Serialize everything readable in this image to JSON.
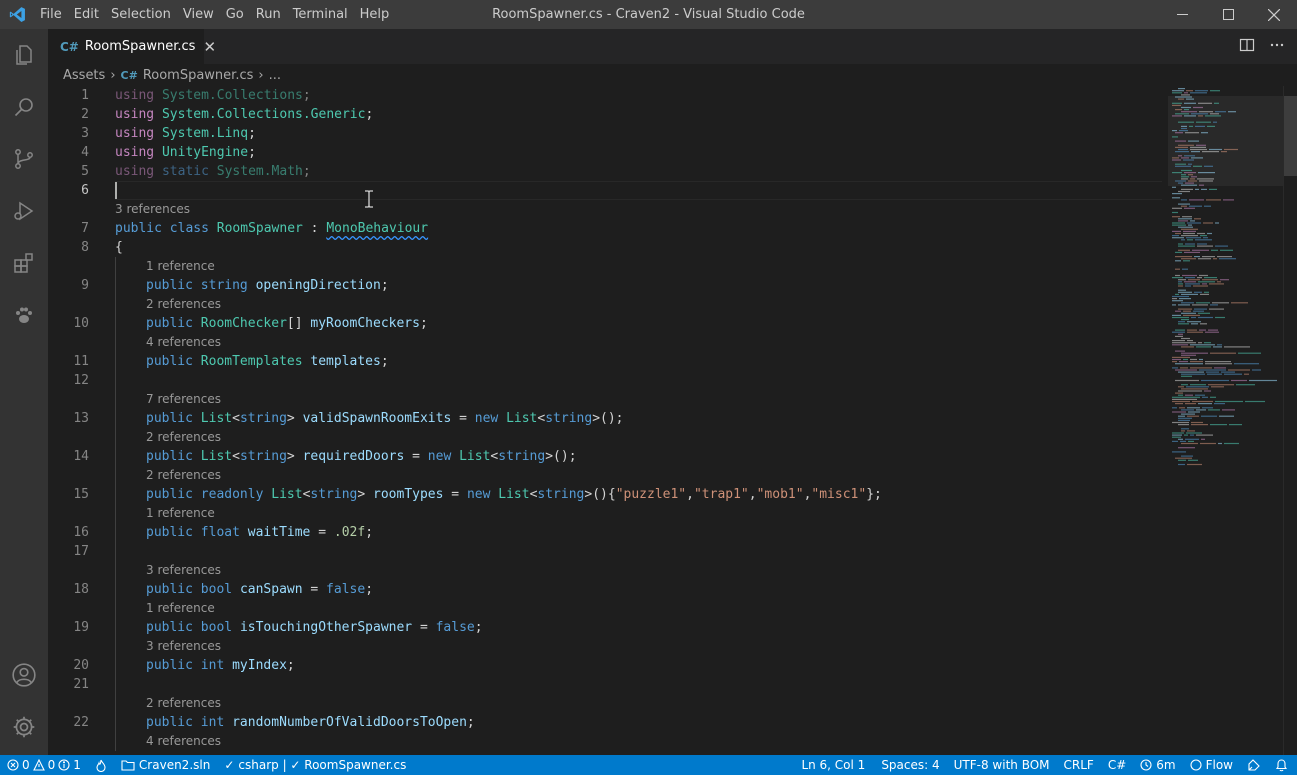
{
  "window": {
    "title": "RoomSpawner.cs - Craven2 - Visual Studio Code",
    "menu": [
      "File",
      "Edit",
      "Selection",
      "View",
      "Go",
      "Run",
      "Terminal",
      "Help"
    ]
  },
  "activity_bar": {
    "items": [
      "explorer-icon",
      "search-icon",
      "source-control-icon",
      "run-debug-icon",
      "extensions-icon",
      "paw-icon"
    ],
    "bottom_items": [
      "accounts-icon",
      "manage-gear-icon"
    ]
  },
  "tab": {
    "icon": "C#",
    "label": "RoomSpawner.cs",
    "close": "✕"
  },
  "breadcrumb": {
    "folder": "Assets",
    "file_icon": "C#",
    "file": "RoomSpawner.cs",
    "more": "..."
  },
  "editor": {
    "rows": [
      {
        "type": "code",
        "ln": "1",
        "tokens": [
          {
            "c": "kwc",
            "t": "using"
          },
          {
            "c": "",
            "t": " "
          },
          {
            "c": "type",
            "t": "System.Collections"
          },
          {
            "c": "",
            "t": ";"
          }
        ],
        "faded": true
      },
      {
        "type": "code",
        "ln": "2",
        "tokens": [
          {
            "c": "kwc",
            "t": "using"
          },
          {
            "c": "",
            "t": " "
          },
          {
            "c": "type",
            "t": "System.Collections.Generic"
          },
          {
            "c": "",
            "t": ";"
          }
        ]
      },
      {
        "type": "code",
        "ln": "3",
        "tokens": [
          {
            "c": "kwc",
            "t": "using"
          },
          {
            "c": "",
            "t": " "
          },
          {
            "c": "type",
            "t": "System.Linq"
          },
          {
            "c": "",
            "t": ";"
          }
        ]
      },
      {
        "type": "code",
        "ln": "4",
        "tokens": [
          {
            "c": "kwc",
            "t": "using"
          },
          {
            "c": "",
            "t": " "
          },
          {
            "c": "type",
            "t": "UnityEngine"
          },
          {
            "c": "",
            "t": ";"
          }
        ]
      },
      {
        "type": "code",
        "ln": "5",
        "tokens": [
          {
            "c": "kwc",
            "t": "using"
          },
          {
            "c": "",
            "t": " "
          },
          {
            "c": "kw",
            "t": "static"
          },
          {
            "c": "",
            "t": " "
          },
          {
            "c": "type",
            "t": "System.Math"
          },
          {
            "c": "",
            "t": ";"
          }
        ],
        "faded": true
      },
      {
        "type": "code",
        "ln": "6",
        "tokens": [],
        "active": true
      },
      {
        "type": "lens",
        "text": "3 references",
        "indent": 0
      },
      {
        "type": "code",
        "ln": "7",
        "tokens": [
          {
            "c": "kw",
            "t": "public"
          },
          {
            "c": "",
            "t": " "
          },
          {
            "c": "kw",
            "t": "class"
          },
          {
            "c": "",
            "t": " "
          },
          {
            "c": "type",
            "t": "RoomSpawner"
          },
          {
            "c": "",
            "t": " : "
          },
          {
            "c": "type squig",
            "t": "MonoBehaviour"
          }
        ]
      },
      {
        "type": "code",
        "ln": "8",
        "tokens": [
          {
            "c": "",
            "t": "{"
          }
        ]
      },
      {
        "type": "lens",
        "text": "1 reference",
        "indent": 1
      },
      {
        "type": "code",
        "ln": "9",
        "indent": 1,
        "tokens": [
          {
            "c": "kw",
            "t": "public"
          },
          {
            "c": "",
            "t": " "
          },
          {
            "c": "kw",
            "t": "string"
          },
          {
            "c": "",
            "t": " "
          },
          {
            "c": "var",
            "t": "openingDirection"
          },
          {
            "c": "",
            "t": ";"
          }
        ]
      },
      {
        "type": "lens",
        "text": "2 references",
        "indent": 1
      },
      {
        "type": "code",
        "ln": "10",
        "indent": 1,
        "tokens": [
          {
            "c": "kw",
            "t": "public"
          },
          {
            "c": "",
            "t": " "
          },
          {
            "c": "type",
            "t": "RoomChecker"
          },
          {
            "c": "",
            "t": "[] "
          },
          {
            "c": "var",
            "t": "myRoomCheckers"
          },
          {
            "c": "",
            "t": ";"
          }
        ]
      },
      {
        "type": "lens",
        "text": "4 references",
        "indent": 1
      },
      {
        "type": "code",
        "ln": "11",
        "indent": 1,
        "tokens": [
          {
            "c": "kw",
            "t": "public"
          },
          {
            "c": "",
            "t": " "
          },
          {
            "c": "type",
            "t": "RoomTemplates"
          },
          {
            "c": "",
            "t": " "
          },
          {
            "c": "var",
            "t": "templates"
          },
          {
            "c": "",
            "t": ";"
          }
        ]
      },
      {
        "type": "code",
        "ln": "12",
        "indent": 1,
        "tokens": []
      },
      {
        "type": "lens",
        "text": "7 references",
        "indent": 1
      },
      {
        "type": "code",
        "ln": "13",
        "indent": 1,
        "tokens": [
          {
            "c": "kw",
            "t": "public"
          },
          {
            "c": "",
            "t": " "
          },
          {
            "c": "type",
            "t": "List"
          },
          {
            "c": "",
            "t": "<"
          },
          {
            "c": "kw",
            "t": "string"
          },
          {
            "c": "",
            "t": "> "
          },
          {
            "c": "var",
            "t": "validSpawnRoomExits"
          },
          {
            "c": "",
            "t": " = "
          },
          {
            "c": "kw",
            "t": "new"
          },
          {
            "c": "",
            "t": " "
          },
          {
            "c": "type",
            "t": "List"
          },
          {
            "c": "",
            "t": "<"
          },
          {
            "c": "kw",
            "t": "string"
          },
          {
            "c": "",
            "t": ">();"
          }
        ]
      },
      {
        "type": "lens",
        "text": "2 references",
        "indent": 1
      },
      {
        "type": "code",
        "ln": "14",
        "indent": 1,
        "tokens": [
          {
            "c": "kw",
            "t": "public"
          },
          {
            "c": "",
            "t": " "
          },
          {
            "c": "type",
            "t": "List"
          },
          {
            "c": "",
            "t": "<"
          },
          {
            "c": "kw",
            "t": "string"
          },
          {
            "c": "",
            "t": "> "
          },
          {
            "c": "var",
            "t": "requiredDoors"
          },
          {
            "c": "",
            "t": " = "
          },
          {
            "c": "kw",
            "t": "new"
          },
          {
            "c": "",
            "t": " "
          },
          {
            "c": "type",
            "t": "List"
          },
          {
            "c": "",
            "t": "<"
          },
          {
            "c": "kw",
            "t": "string"
          },
          {
            "c": "",
            "t": ">();"
          }
        ]
      },
      {
        "type": "lens",
        "text": "2 references",
        "indent": 1
      },
      {
        "type": "code",
        "ln": "15",
        "indent": 1,
        "tokens": [
          {
            "c": "kw",
            "t": "public"
          },
          {
            "c": "",
            "t": " "
          },
          {
            "c": "kw",
            "t": "readonly"
          },
          {
            "c": "",
            "t": " "
          },
          {
            "c": "type",
            "t": "List"
          },
          {
            "c": "",
            "t": "<"
          },
          {
            "c": "kw",
            "t": "string"
          },
          {
            "c": "",
            "t": "> "
          },
          {
            "c": "var",
            "t": "roomTypes"
          },
          {
            "c": "",
            "t": " = "
          },
          {
            "c": "kw",
            "t": "new"
          },
          {
            "c": "",
            "t": " "
          },
          {
            "c": "type",
            "t": "List"
          },
          {
            "c": "",
            "t": "<"
          },
          {
            "c": "kw",
            "t": "string"
          },
          {
            "c": "",
            "t": ">(){"
          },
          {
            "c": "str",
            "t": "\"puzzle1\""
          },
          {
            "c": "",
            "t": ","
          },
          {
            "c": "str",
            "t": "\"trap1\""
          },
          {
            "c": "",
            "t": ","
          },
          {
            "c": "str",
            "t": "\"mob1\""
          },
          {
            "c": "",
            "t": ","
          },
          {
            "c": "str",
            "t": "\"misc1\""
          },
          {
            "c": "",
            "t": "};"
          }
        ]
      },
      {
        "type": "lens",
        "text": "1 reference",
        "indent": 1
      },
      {
        "type": "code",
        "ln": "16",
        "indent": 1,
        "tokens": [
          {
            "c": "kw",
            "t": "public"
          },
          {
            "c": "",
            "t": " "
          },
          {
            "c": "kw",
            "t": "float"
          },
          {
            "c": "",
            "t": " "
          },
          {
            "c": "var",
            "t": "waitTime"
          },
          {
            "c": "",
            "t": " = "
          },
          {
            "c": "num",
            "t": ".02f"
          },
          {
            "c": "",
            "t": ";"
          }
        ]
      },
      {
        "type": "code",
        "ln": "17",
        "indent": 1,
        "tokens": []
      },
      {
        "type": "lens",
        "text": "3 references",
        "indent": 1
      },
      {
        "type": "code",
        "ln": "18",
        "indent": 1,
        "tokens": [
          {
            "c": "kw",
            "t": "public"
          },
          {
            "c": "",
            "t": " "
          },
          {
            "c": "kw",
            "t": "bool"
          },
          {
            "c": "",
            "t": " "
          },
          {
            "c": "var",
            "t": "canSpawn"
          },
          {
            "c": "",
            "t": " = "
          },
          {
            "c": "kw",
            "t": "false"
          },
          {
            "c": "",
            "t": ";"
          }
        ]
      },
      {
        "type": "lens",
        "text": "1 reference",
        "indent": 1
      },
      {
        "type": "code",
        "ln": "19",
        "indent": 1,
        "tokens": [
          {
            "c": "kw",
            "t": "public"
          },
          {
            "c": "",
            "t": " "
          },
          {
            "c": "kw",
            "t": "bool"
          },
          {
            "c": "",
            "t": " "
          },
          {
            "c": "var",
            "t": "isTouchingOtherSpawner"
          },
          {
            "c": "",
            "t": " = "
          },
          {
            "c": "kw",
            "t": "false"
          },
          {
            "c": "",
            "t": ";"
          }
        ]
      },
      {
        "type": "lens",
        "text": "3 references",
        "indent": 1
      },
      {
        "type": "code",
        "ln": "20",
        "indent": 1,
        "tokens": [
          {
            "c": "kw",
            "t": "public"
          },
          {
            "c": "",
            "t": " "
          },
          {
            "c": "kw",
            "t": "int"
          },
          {
            "c": "",
            "t": " "
          },
          {
            "c": "var",
            "t": "myIndex"
          },
          {
            "c": "",
            "t": ";"
          }
        ]
      },
      {
        "type": "code",
        "ln": "21",
        "indent": 1,
        "tokens": []
      },
      {
        "type": "lens",
        "text": "2 references",
        "indent": 1
      },
      {
        "type": "code",
        "ln": "22",
        "indent": 1,
        "tokens": [
          {
            "c": "kw",
            "t": "public"
          },
          {
            "c": "",
            "t": " "
          },
          {
            "c": "kw",
            "t": "int"
          },
          {
            "c": "",
            "t": " "
          },
          {
            "c": "var",
            "t": "randomNumberOfValidDoorsToOpen"
          },
          {
            "c": "",
            "t": ";"
          }
        ]
      },
      {
        "type": "lens",
        "text": "4 references",
        "indent": 1
      }
    ]
  },
  "status_bar": {
    "errors": "0",
    "warnings": "0",
    "infos": "1",
    "solution": "Craven2.sln",
    "project": "csharp | ✓ RoomSpawner.cs",
    "position": "Ln 6, Col 1",
    "spaces": "Spaces: 4",
    "encoding": "UTF-8 with BOM",
    "eol": "CRLF",
    "language": "C#",
    "time": "6m",
    "flow": "Flow"
  },
  "colors": {
    "accent": "#007acc",
    "title_bar": "#3c3c3c",
    "activity_bar": "#333333",
    "editor_bg": "#1e1e1e"
  }
}
